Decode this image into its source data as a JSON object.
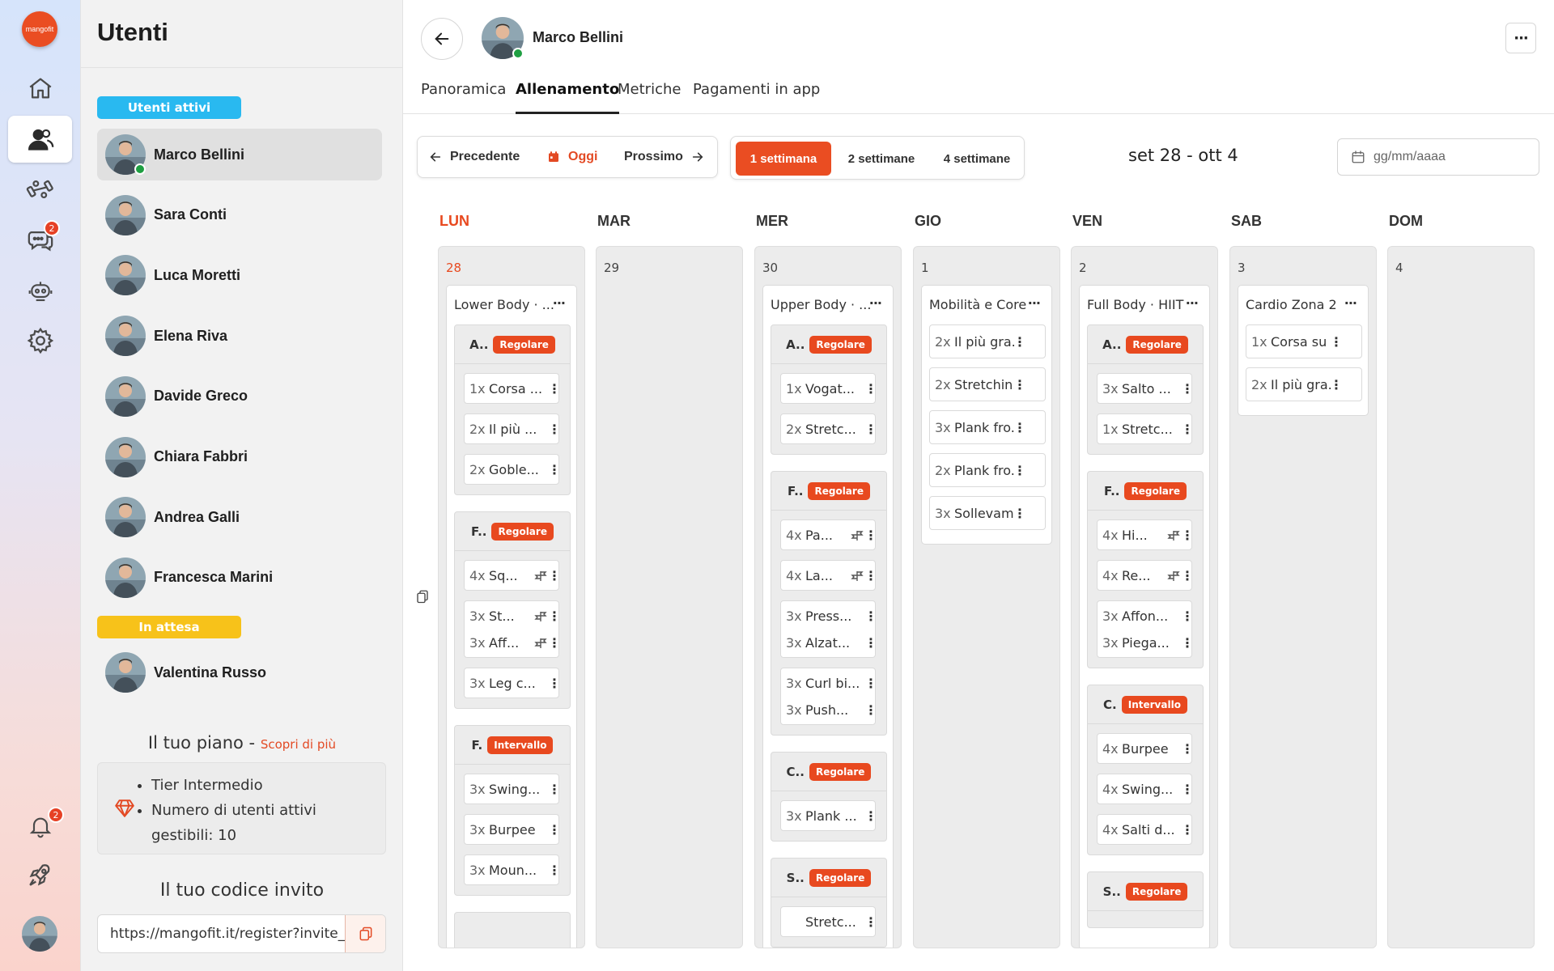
{
  "app": {
    "logo_text": "mangofit"
  },
  "rail": {
    "items": [
      {
        "icon": "home-icon",
        "active": false,
        "badge": ""
      },
      {
        "icon": "users-icon",
        "active": true,
        "badge": ""
      },
      {
        "icon": "dumbbell-icon",
        "active": false,
        "badge": ""
      },
      {
        "icon": "chat-icon",
        "active": false,
        "badge": "2"
      },
      {
        "icon": "robot-icon",
        "active": false,
        "badge": ""
      },
      {
        "icon": "gear-icon",
        "active": false,
        "badge": ""
      }
    ],
    "bell_badge": "2"
  },
  "users": {
    "title": "Utenti",
    "active_label": "Utenti attivi",
    "active": [
      "Marco Bellini",
      "Sara Conti",
      "Luca Moretti",
      "Elena Riva",
      "Davide Greco",
      "Chiara Fabbri",
      "Andrea Galli",
      "Francesca Marini"
    ],
    "pending_label": "In attesa",
    "pending": [
      "Valentina Russo"
    ],
    "plan_title": "Il tuo piano -",
    "plan_link": "Scopri di più",
    "plan_items": [
      "Tier Intermedio",
      "Numero di utenti attivi gestibili: 10"
    ],
    "invite_title": "Il tuo codice invito",
    "invite_url": "https://mangofit.it/register?invite_"
  },
  "profile": {
    "name": "Marco Bellini",
    "more": "···",
    "tabs": [
      "Panoramica",
      "Allenamento",
      "Metriche",
      "Pagamenti in app"
    ],
    "active_tab": 1
  },
  "nav": {
    "prev": "Precedente",
    "today": "Oggi",
    "next": "Prossimo"
  },
  "weeks": {
    "options": [
      "1 settimana",
      "2 settimane",
      "4 settimane"
    ],
    "active": 0
  },
  "range": "set 28 - ott 4",
  "date_placeholder": "gg/mm/aaaa",
  "colors": {
    "accent": "#ea4d22",
    "pending": "#f7c21a",
    "active": "#29b9f0",
    "online": "#1f9f42"
  },
  "days": [
    {
      "label": "LUN",
      "num": "28",
      "today": true,
      "workout": {
        "title": "Lower Body · ...",
        "blocks": [
          {
            "prefix": "A..",
            "tag": "Regolare",
            "ex": [
              [
                [
                  "1x",
                  "Corsa ..."
                ]
              ],
              [
                [
                  "2x",
                  "Il più ..."
                ]
              ],
              [
                [
                  "2x",
                  "Goble..."
                ]
              ]
            ]
          },
          {
            "prefix": "F..",
            "tag": "Regolare",
            "ex": [
              [
                [
                  "4x",
                  "Sq...",
                  true
                ]
              ],
              [
                [
                  "3x",
                  "St...",
                  true
                ],
                [
                  "3x",
                  "Aff...",
                  true
                ]
              ],
              [
                [
                  "3x",
                  "Leg c..."
                ]
              ]
            ]
          },
          {
            "prefix": "F.",
            "tag": "Intervallo",
            "ex": [
              [
                [
                  "3x",
                  "Swing..."
                ]
              ],
              [
                [
                  "3x",
                  "Burpee"
                ]
              ],
              [
                [
                  "3x",
                  "Moun..."
                ]
              ]
            ]
          },
          {
            "prefix": "",
            "tag": "",
            "ex": []
          }
        ]
      }
    },
    {
      "label": "MAR",
      "num": "29",
      "today": false,
      "workout": null
    },
    {
      "label": "MER",
      "num": "30",
      "today": false,
      "workout": {
        "title": "Upper Body · ...",
        "blocks": [
          {
            "prefix": "A..",
            "tag": "Regolare",
            "ex": [
              [
                [
                  "1x",
                  "Vogat..."
                ]
              ],
              [
                [
                  "2x",
                  "Stretc..."
                ]
              ]
            ]
          },
          {
            "prefix": "F..",
            "tag": "Regolare",
            "ex": [
              [
                [
                  "4x",
                  "Pa...",
                  true
                ]
              ],
              [
                [
                  "4x",
                  "La...",
                  true
                ]
              ],
              [
                [
                  "3x",
                  "Press..."
                ],
                [
                  "3x",
                  "Alzat..."
                ]
              ],
              [
                [
                  "3x",
                  "Curl bi..."
                ],
                [
                  "3x",
                  "Push..."
                ]
              ]
            ]
          },
          {
            "prefix": "C..",
            "tag": "Regolare",
            "ex": [
              [
                [
                  "3x",
                  "Plank ..."
                ]
              ]
            ]
          },
          {
            "prefix": "S..",
            "tag": "Regolare",
            "ex": [
              [
                [
                  "",
                  "Stretc..."
                ]
              ]
            ]
          }
        ]
      }
    },
    {
      "label": "GIO",
      "num": "1",
      "today": false,
      "workout": {
        "title": "Mobilità e Core",
        "blocks": [],
        "flat": [
          [
            "2x",
            "Il più gra..."
          ],
          [
            "2x",
            "Stretchin..."
          ],
          [
            "3x",
            "Plank fro..."
          ],
          [
            "2x",
            "Plank fro..."
          ],
          [
            "3x",
            "Sollevam..."
          ]
        ]
      }
    },
    {
      "label": "VEN",
      "num": "2",
      "today": false,
      "workout": {
        "title": "Full Body · HIIT",
        "blocks": [
          {
            "prefix": "A..",
            "tag": "Regolare",
            "ex": [
              [
                [
                  "3x",
                  "Salto ..."
                ]
              ],
              [
                [
                  "1x",
                  "Stretc..."
                ]
              ]
            ]
          },
          {
            "prefix": "F..",
            "tag": "Regolare",
            "ex": [
              [
                [
                  "4x",
                  "Hi...",
                  true
                ]
              ],
              [
                [
                  "4x",
                  "Re...",
                  true
                ]
              ],
              [
                [
                  "3x",
                  "Affon..."
                ],
                [
                  "3x",
                  "Piega..."
                ]
              ]
            ]
          },
          {
            "prefix": "C.",
            "tag": "Intervallo",
            "ex": [
              [
                [
                  "4x",
                  "Burpee"
                ]
              ],
              [
                [
                  "4x",
                  "Swing..."
                ]
              ],
              [
                [
                  "4x",
                  "Salti d..."
                ]
              ]
            ]
          },
          {
            "prefix": "S..",
            "tag": "Regolare",
            "ex": []
          }
        ]
      }
    },
    {
      "label": "SAB",
      "num": "3",
      "today": false,
      "workout": {
        "title": "Cardio Zona 2",
        "blocks": [],
        "flat": [
          [
            "1x",
            "Corsa su ..."
          ],
          [
            "2x",
            "Il più gra..."
          ]
        ]
      }
    },
    {
      "label": "DOM",
      "num": "4",
      "today": false,
      "workout": null
    }
  ]
}
